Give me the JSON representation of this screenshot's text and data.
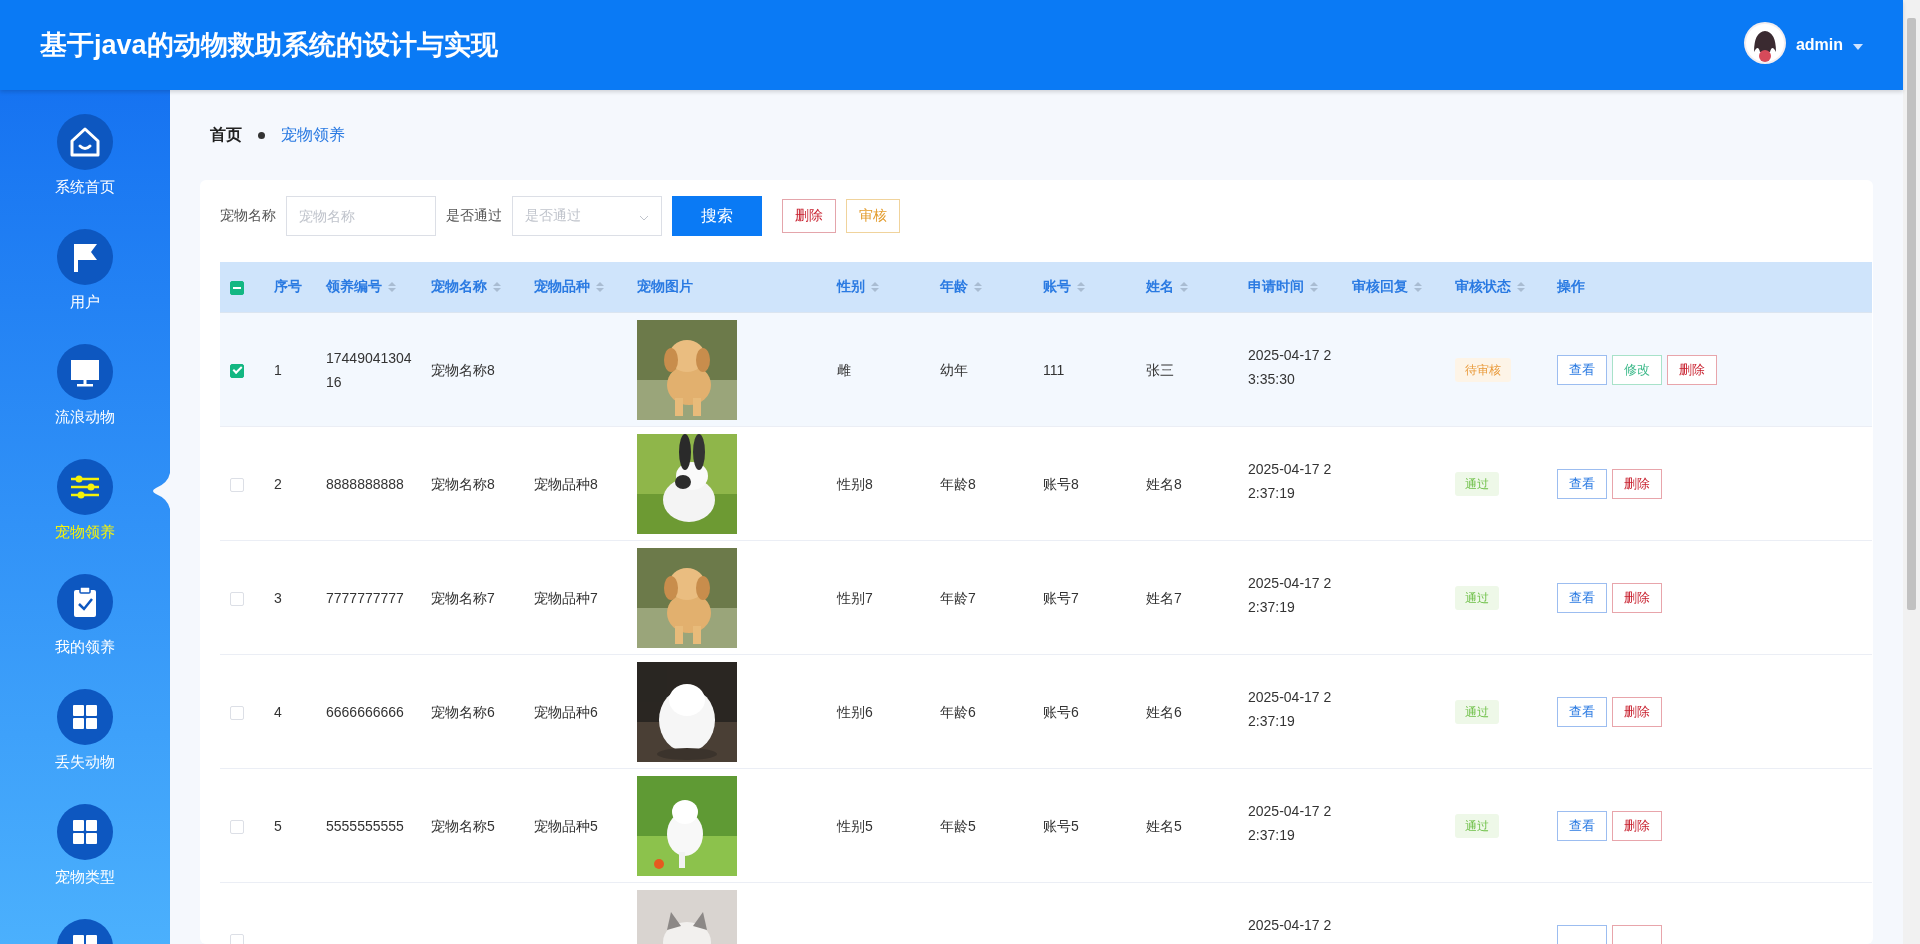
{
  "header": {
    "title": "基于java的动物救助系统的设计与实现",
    "user": {
      "name": "admin"
    }
  },
  "sidebar": {
    "items": [
      {
        "label": "系统首页",
        "selected": false
      },
      {
        "label": "用户",
        "selected": false
      },
      {
        "label": "流浪动物",
        "selected": false
      },
      {
        "label": "宠物领养",
        "selected": true
      },
      {
        "label": "我的领养",
        "selected": false
      },
      {
        "label": "丢失动物",
        "selected": false
      },
      {
        "label": "宠物类型",
        "selected": false
      },
      {
        "selected": false
      }
    ]
  },
  "breadcrumb": [
    "首页",
    "宠物领养"
  ],
  "search": {
    "fields": [
      {
        "label": "宠物名称",
        "placeholder": "宠物名称",
        "kind": "text"
      },
      {
        "label": "是否通过",
        "placeholder": "是否通过",
        "kind": "select"
      }
    ],
    "buttons": [
      {
        "label": "搜索",
        "kind": "primary"
      },
      {
        "label": "删除",
        "kind": "danger"
      },
      {
        "label": "审核",
        "kind": "warning"
      }
    ]
  },
  "table": {
    "select_all": {
      "indeterminate": true
    },
    "columns": [
      {
        "label": "序号",
        "sortable": false
      },
      {
        "label": "领养编号",
        "sortable": true
      },
      {
        "label": "宠物名称",
        "sortable": true
      },
      {
        "label": "宠物品种",
        "sortable": true
      },
      {
        "label": "宠物图片",
        "sortable": false
      },
      {
        "label": "性别",
        "sortable": true
      },
      {
        "label": "年龄",
        "sortable": true
      },
      {
        "label": "账号",
        "sortable": true
      },
      {
        "label": "姓名",
        "sortable": true
      },
      {
        "label": "申请时间",
        "sortable": true
      },
      {
        "label": "审核回复",
        "sortable": true
      },
      {
        "label": "审核状态",
        "sortable": true
      },
      {
        "label": "操作",
        "sortable": false
      }
    ],
    "rows": [
      {
        "selected": true,
        "no": "1",
        "adoption_id": "1744904130416",
        "pet_name": "宠物名称8",
        "photo": {
          "kind": "picture"
        },
        "gender": "雌",
        "age": "幼年",
        "account": "111",
        "name": "张三",
        "applied_at": "2025-04-17 23:35:30",
        "status": {
          "label": "待审核",
          "kind": "pending"
        },
        "actions": [
          {
            "label": "查看",
            "kind": "view"
          },
          {
            "label": "修改",
            "kind": "edit"
          },
          {
            "label": "删除",
            "kind": "delete"
          }
        ]
      },
      {
        "selected": false,
        "no": "2",
        "adoption_id": "8888888888",
        "pet_name": "宠物名称8",
        "breed": "宠物品种8",
        "photo": {
          "kind": "picture"
        },
        "gender": "性别8",
        "age": "年龄8",
        "account": "账号8",
        "name": "姓名8",
        "applied_at": "2025-04-17 22:37:19",
        "status": {
          "label": "通过",
          "kind": "passed"
        },
        "actions": [
          {
            "label": "查看",
            "kind": "view"
          },
          {
            "label": "删除",
            "kind": "delete"
          }
        ]
      },
      {
        "selected": false,
        "no": "3",
        "adoption_id": "7777777777",
        "pet_name": "宠物名称7",
        "breed": "宠物品种7",
        "photo": {
          "kind": "picture"
        },
        "gender": "性别7",
        "age": "年龄7",
        "account": "账号7",
        "name": "姓名7",
        "applied_at": "2025-04-17 22:37:19",
        "status": {
          "label": "通过",
          "kind": "passed"
        },
        "actions": [
          {
            "label": "查看",
            "kind": "view"
          },
          {
            "label": "删除",
            "kind": "delete"
          }
        ]
      },
      {
        "selected": false,
        "no": "4",
        "adoption_id": "6666666666",
        "pet_name": "宠物名称6",
        "breed": "宠物品种6",
        "photo": {
          "kind": "picture"
        },
        "gender": "性别6",
        "age": "年龄6",
        "account": "账号6",
        "name": "姓名6",
        "applied_at": "2025-04-17 22:37:19",
        "status": {
          "label": "通过",
          "kind": "passed"
        },
        "actions": [
          {
            "label": "查看",
            "kind": "view"
          },
          {
            "label": "删除",
            "kind": "delete"
          }
        ]
      },
      {
        "selected": false,
        "no": "5",
        "adoption_id": "5555555555",
        "pet_name": "宠物名称5",
        "breed": "宠物品种5",
        "photo": {
          "kind": "picture"
        },
        "gender": "性别5",
        "age": "年龄5",
        "account": "账号5",
        "name": "姓名5",
        "applied_at": "2025-04-17 22:37:19",
        "status": {
          "label": "通过",
          "kind": "passed"
        },
        "actions": [
          {
            "label": "查看",
            "kind": "view"
          },
          {
            "label": "删除",
            "kind": "delete"
          }
        ]
      },
      {
        "selected": false,
        "photo": {
          "kind": "picture"
        },
        "applied_at": "2025-04-17 2",
        "actions": [
          {
            "kind": "view"
          },
          {
            "kind": "delete"
          }
        ]
      }
    ]
  }
}
